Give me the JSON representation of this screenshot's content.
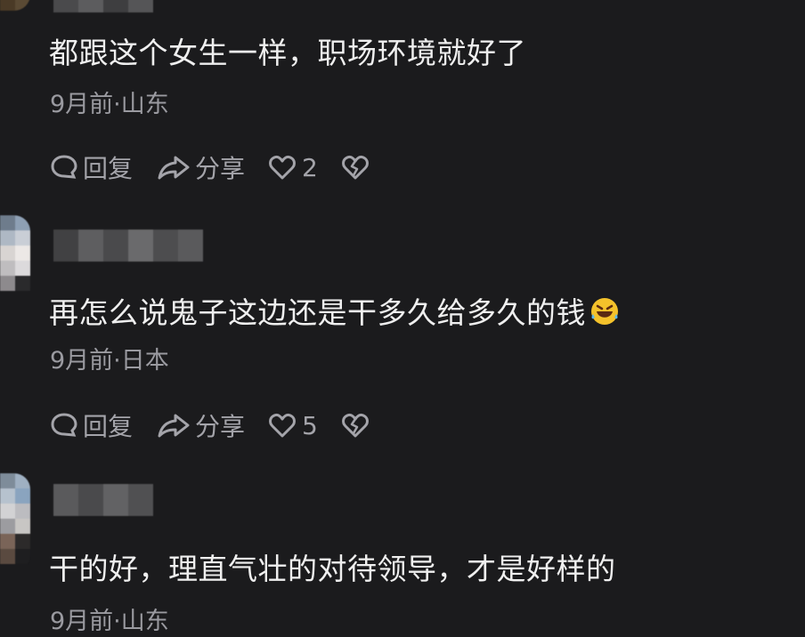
{
  "comments": [
    {
      "text": "都跟这个女生一样，职场环境就好了",
      "meta": "9月前·山东",
      "reply_label": "回复",
      "share_label": "分享",
      "likes": "2"
    },
    {
      "text": "再怎么说鬼子这边还是干多久给多久的钱",
      "emoji": "rofl-emoji",
      "meta": "9月前·日本",
      "reply_label": "回复",
      "share_label": "分享",
      "likes": "5"
    },
    {
      "text": "干的好，理直气壮的对待领导，才是好样的",
      "meta": "9月前·山东"
    }
  ],
  "icons": {
    "reply": "comment-bubble-icon",
    "share": "share-arrow-icon",
    "like": "heart-icon",
    "dislike": "broken-heart-icon"
  },
  "colors": {
    "background": "#1b1b1d",
    "text": "#efefef",
    "meta": "#9a9aa0",
    "action": "#a4a4aa"
  }
}
